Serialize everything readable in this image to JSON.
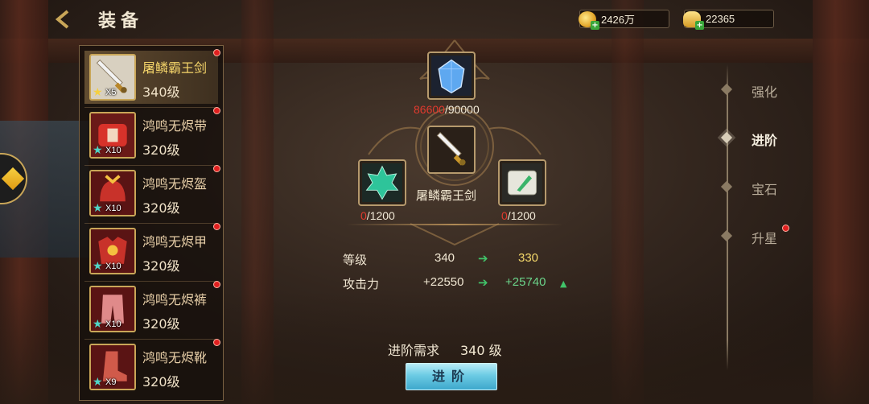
{
  "header": {
    "back_icon": "chevron-left-icon",
    "title": "装备",
    "currencies": [
      {
        "icon": "gold-coin-icon",
        "value": "2426万"
      },
      {
        "icon": "gold-ingot-icon",
        "value": "22365"
      }
    ]
  },
  "equipment_list": [
    {
      "name": "屠鳞霸王剑",
      "level": "340级",
      "count": "X5",
      "star_color": "#f5d040",
      "icon": "sword-icon",
      "selected": true
    },
    {
      "name": "鸿鸣无烬带",
      "level": "320级",
      "count": "X10",
      "star_color": "#4fd6c8",
      "icon": "belt-icon",
      "selected": false
    },
    {
      "name": "鸿鸣无烬盔",
      "level": "320级",
      "count": "X10",
      "star_color": "#4fd6c8",
      "icon": "helmet-icon",
      "selected": false
    },
    {
      "name": "鸿鸣无烬甲",
      "level": "320级",
      "count": "X10",
      "star_color": "#4fd6c8",
      "icon": "armor-icon",
      "selected": false
    },
    {
      "name": "鸿鸣无烬裤",
      "level": "320级",
      "count": "X10",
      "star_color": "#4fd6c8",
      "icon": "pants-icon",
      "selected": false
    },
    {
      "name": "鸿鸣无烬靴",
      "level": "320级",
      "count": "X9",
      "star_color": "#4fd6c8",
      "icon": "boots-icon",
      "selected": false
    }
  ],
  "advance": {
    "top_material": {
      "icon": "blue-crystal-icon",
      "current": "86600",
      "sep": "/",
      "required": "90000"
    },
    "center_item": {
      "icon": "sword-icon",
      "name": "屠鳞霸王剑"
    },
    "left_material": {
      "icon": "green-gem-icon",
      "current": "0",
      "sep": "/",
      "required": "1200"
    },
    "right_material": {
      "icon": "scroll-icon",
      "current": "0",
      "sep": "/",
      "required": "1200"
    },
    "stats": [
      {
        "label": "等级",
        "from": "340",
        "to": "330",
        "increase": false
      },
      {
        "label": "攻击力",
        "from": "+22550",
        "to": "+25740",
        "increase": true
      }
    ],
    "requirement_label": "进阶需求",
    "requirement_value": "340 级",
    "button_label": "进阶"
  },
  "tabs": [
    {
      "label": "强化",
      "active": false,
      "dot": false
    },
    {
      "label": "进阶",
      "active": true,
      "dot": false
    },
    {
      "label": "宝石",
      "active": false,
      "dot": false
    },
    {
      "label": "升星",
      "active": false,
      "dot": true
    }
  ],
  "colors": {
    "accent_gold": "#c9a658",
    "progress_red": "#e03a2e",
    "stat_green": "#6bd48a",
    "button_blue": "#6ccbe4",
    "notify_red": "#e02020"
  }
}
